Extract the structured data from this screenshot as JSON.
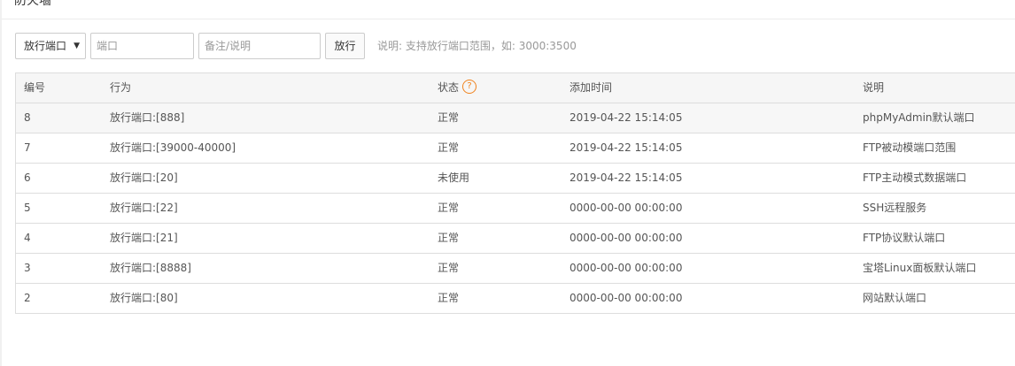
{
  "panel": {
    "title": "防火墙"
  },
  "toolbar": {
    "select_value": "放行端口",
    "caret_glyph": "▼",
    "port_placeholder": "端口",
    "note_placeholder": "备注/说明",
    "allow_button": "放行",
    "hint": "说明: 支持放行端口范围，如: 3000:3500"
  },
  "table": {
    "columns": [
      "编号",
      "行为",
      "状态",
      "添加时间",
      "说明"
    ],
    "status_help_glyph": "?",
    "rows": [
      {
        "id": "8",
        "action": "放行端口:[888]",
        "status": "正常",
        "added": "2019-04-22 15:14:05",
        "note": "phpMyAdmin默认端口"
      },
      {
        "id": "7",
        "action": "放行端口:[39000-40000]",
        "status": "正常",
        "added": "2019-04-22 15:14:05",
        "note": "FTP被动模端口范围"
      },
      {
        "id": "6",
        "action": "放行端口:[20]",
        "status": "未使用",
        "added": "2019-04-22 15:14:05",
        "note": "FTP主动模式数据端口"
      },
      {
        "id": "5",
        "action": "放行端口:[22]",
        "status": "正常",
        "added": "0000-00-00 00:00:00",
        "note": "SSH远程服务"
      },
      {
        "id": "4",
        "action": "放行端口:[21]",
        "status": "正常",
        "added": "0000-00-00 00:00:00",
        "note": "FTP协议默认端口"
      },
      {
        "id": "3",
        "action": "放行端口:[8888]",
        "status": "正常",
        "added": "0000-00-00 00:00:00",
        "note": "宝塔Linux面板默认端口"
      },
      {
        "id": "2",
        "action": "放行端口:[80]",
        "status": "正常",
        "added": "0000-00-00 00:00:00",
        "note": "网站默认端口"
      }
    ]
  }
}
